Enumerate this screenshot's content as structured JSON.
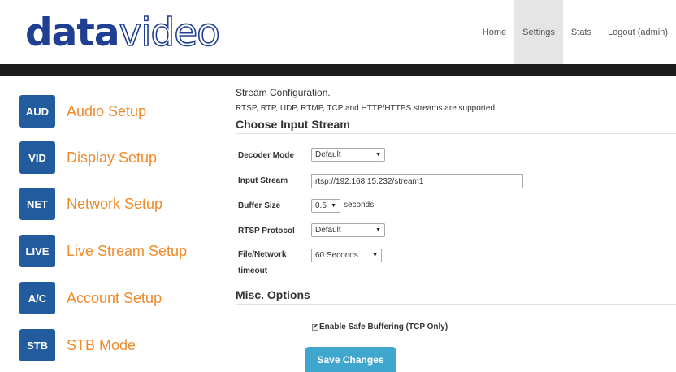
{
  "header": {
    "logo": {
      "bold": "data",
      "thin": "video"
    },
    "nav": [
      {
        "label": "Home",
        "active": false
      },
      {
        "label": "Settings",
        "active": true
      },
      {
        "label": "Stats",
        "active": false
      },
      {
        "label": "Logout (admin)",
        "active": false
      }
    ]
  },
  "sidebar": {
    "items": [
      {
        "badge": "AUD",
        "label": "Audio Setup"
      },
      {
        "badge": "VID",
        "label": "Display Setup"
      },
      {
        "badge": "NET",
        "label": "Network Setup"
      },
      {
        "badge": "LIVE",
        "label": "Live Stream Setup"
      },
      {
        "badge": "A/C",
        "label": "Account Setup"
      },
      {
        "badge": "STB",
        "label": "STB Mode"
      }
    ]
  },
  "main": {
    "intro": "Stream Configuration.",
    "supported": "RTSP, RTP, UDP, RTMP, TCP and HTTP/HTTPS streams are supported",
    "input_section_title": "Choose Input Stream",
    "fields": {
      "decoder_mode": {
        "label": "Decoder Mode",
        "value": "Default"
      },
      "input_stream": {
        "label": "Input Stream",
        "value": "rtsp://192.168.15.232/stream1"
      },
      "buffer_size": {
        "label": "Buffer Size",
        "value": "0.5",
        "unit": "seconds"
      },
      "rtsp_protocol": {
        "label": "RTSP Protocol",
        "value": "Default"
      },
      "file_network_timeout": {
        "label_line1": "File/Network",
        "label_line2": "timeout",
        "value": "60 Seconds"
      }
    },
    "misc_section_title": "Misc. Options",
    "safe_buffering": {
      "label": "Enable Safe Buffering (TCP Only)",
      "checked": true
    },
    "save_label": "Save Changes"
  },
  "colors": {
    "brand": "#1f3f93",
    "sidebar_badge": "#235c9e",
    "sidebar_label": "#ef8a2a",
    "save_button": "#3fa7cd",
    "top_bar": "#1c1c1c",
    "nav_active": "#e5e5e5"
  },
  "icons": {
    "select_arrow": "dropdown-arrow-icon",
    "checkbox_mark": "checkmark-icon"
  }
}
